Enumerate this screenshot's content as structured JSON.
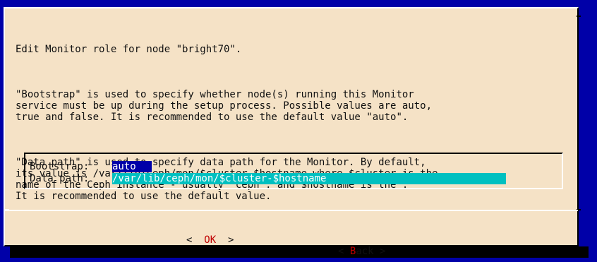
{
  "dialog": {
    "title": "Edit Monitor role for node \"bright70\".",
    "paragraphs": [
      "\"Bootstrap\" is used to specify whether node(s) running this Monitor\nservice must be up during the setup process. Possible values are auto,\ntrue and false. It is recommended to use the default value \"auto\".",
      "\"Data path\" is used to specify data path for the Monitor. By default,\nits value is /var/lib/ceph/mon/$cluster-$hostname where $cluster is the\nname of the Ceph instance - usually \"ceph\", and $hostname is the .\nIt is recommended to use the default value."
    ]
  },
  "form": {
    "bootstrap": {
      "label": "Bootstrap:",
      "value": "auto"
    },
    "data_path": {
      "label": "Data path:",
      "value": "/var/lib/ceph/mon/$cluster-$hostname"
    }
  },
  "buttons": {
    "ok": {
      "left_bracket": "<",
      "hotkey": "O",
      "rest": "K",
      "right_bracket": ">"
    },
    "back": {
      "left_bracket": "<",
      "hotkey": "B",
      "rest": "ack",
      "right_bracket": ">"
    }
  },
  "colors": {
    "background": "#0000a8",
    "dialog": "#f5e2c6",
    "selected_field": "#0000a8",
    "field": "#00c0c0",
    "hotkey": "#c00000"
  }
}
